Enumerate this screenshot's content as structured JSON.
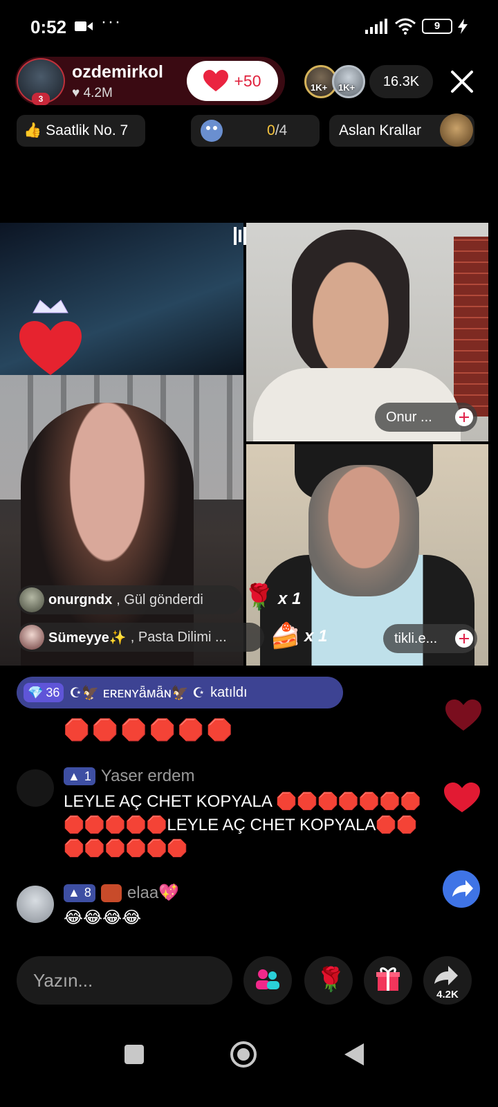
{
  "status_bar": {
    "time": "0:52",
    "more": "···",
    "battery": "9"
  },
  "host": {
    "name": "ozdemirkol",
    "likes": "4.2M",
    "badge_level": "3",
    "like_button": "+50"
  },
  "viewers": {
    "badges": [
      "1K+",
      "1K+"
    ],
    "count": "16.3K"
  },
  "chips": {
    "hourly_rank": "Saatlik No. 7",
    "progress_done": "0",
    "progress_total": "/4",
    "team": "Aslan Krallar"
  },
  "streams": [
    {
      "name": "Onur ..."
    },
    {
      "name": "tikli.e..."
    }
  ],
  "gift_feed": [
    {
      "user": "onurgndx",
      "action": ", Gül  gönderdi",
      "count": "x 1"
    },
    {
      "user": "Sümeyye✨",
      "action": ", Pasta Dilimi ...",
      "count": "x 1"
    }
  ],
  "join_notice": {
    "level": "36",
    "user": "☪︎🦅 ᴇʀᴇɴʏǟᴍǟɴ🦅 ☪︎",
    "action": "katıldı"
  },
  "chat": [
    {
      "kind": "dots",
      "text": "🛑🛑🛑🛑🛑🛑"
    },
    {
      "kind": "message",
      "level": "1",
      "user": "Yaser erdem",
      "lines": [
        "LEYLE AÇ CHET KOPYALA 🛑🛑🛑🛑🛑🛑🛑",
        "🛑🛑🛑🛑🛑LEYLE AÇ CHET KOPYALA🛑🛑",
        "🛑🛑🛑🛑🛑🛑"
      ]
    },
    {
      "kind": "message",
      "level": "8",
      "user": "elaa💖",
      "lines": [
        "😂😂😂😂"
      ]
    }
  ],
  "bottom_bar": {
    "input_placeholder": "Yazın...",
    "share_count": "4.2K"
  },
  "colors": {
    "accent": "#e0223d",
    "join_bg": "#3d4393",
    "fab": "#3f74e6"
  }
}
